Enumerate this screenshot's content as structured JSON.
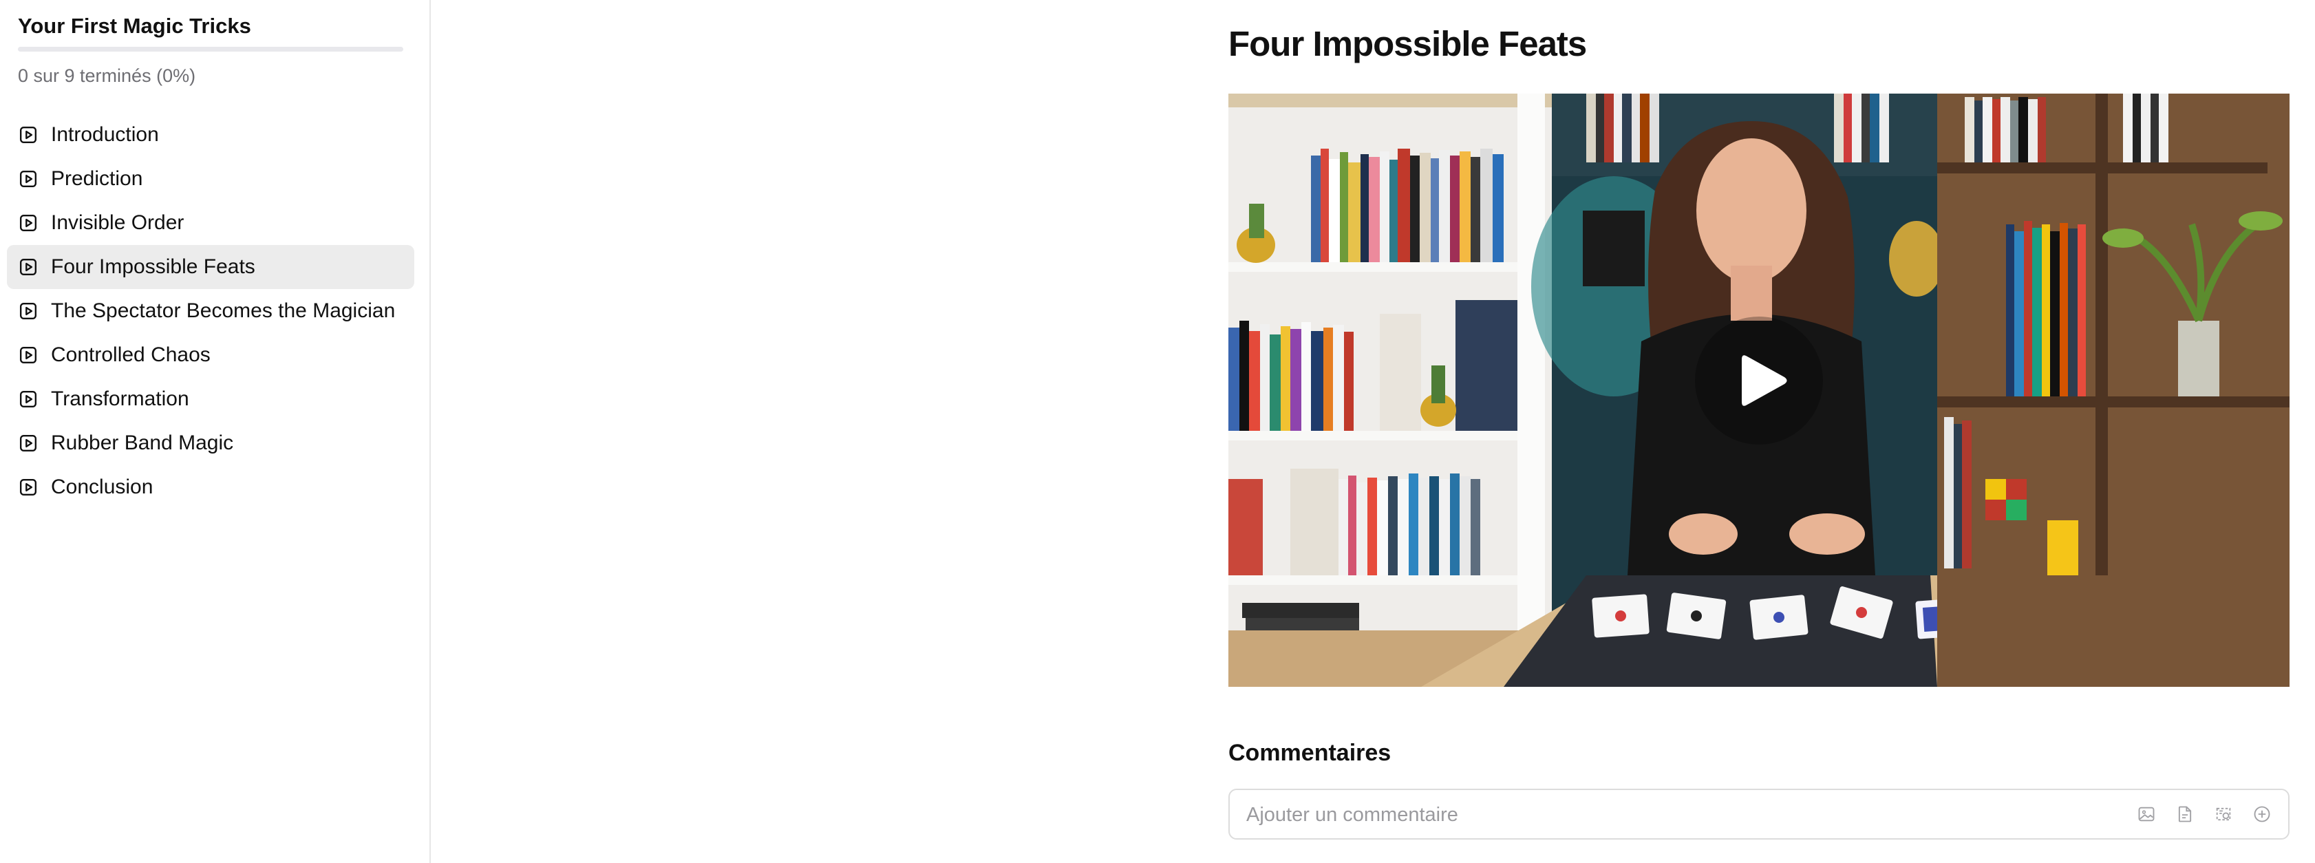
{
  "sidebar": {
    "course_title": "Your First Magic Tricks",
    "progress": {
      "text": "0 sur 9 terminés (0%)",
      "completed": 0,
      "total": 9,
      "percent": 0
    },
    "lessons": [
      {
        "label": "Introduction",
        "icon": "play-square-icon",
        "active": false
      },
      {
        "label": "Prediction",
        "icon": "play-square-icon",
        "active": false
      },
      {
        "label": "Invisible Order",
        "icon": "play-square-icon",
        "active": false
      },
      {
        "label": "Four Impossible Feats",
        "icon": "play-square-icon",
        "active": true
      },
      {
        "label": "The Spectator Becomes the Magician",
        "icon": "play-square-icon",
        "active": false
      },
      {
        "label": "Controlled Chaos",
        "icon": "play-square-icon",
        "active": false
      },
      {
        "label": "Transformation",
        "icon": "play-square-icon",
        "active": false
      },
      {
        "label": "Rubber Band Magic",
        "icon": "play-square-icon",
        "active": false
      },
      {
        "label": "Conclusion",
        "icon": "play-square-icon",
        "active": false
      }
    ]
  },
  "main": {
    "lesson_title": "Four Impossible Feats",
    "video": {
      "play_icon": "play-icon"
    },
    "comments": {
      "title": "Commentaires",
      "input_placeholder": "Ajouter un commentaire",
      "input_value": "",
      "tools": [
        "image-icon",
        "file-icon",
        "gif-icon",
        "add-circle-icon"
      ]
    }
  },
  "colors": {
    "active_item_bg": "#ececec",
    "text": "#111111",
    "muted_text": "#6e6e73",
    "border": "#dcdcdc"
  }
}
